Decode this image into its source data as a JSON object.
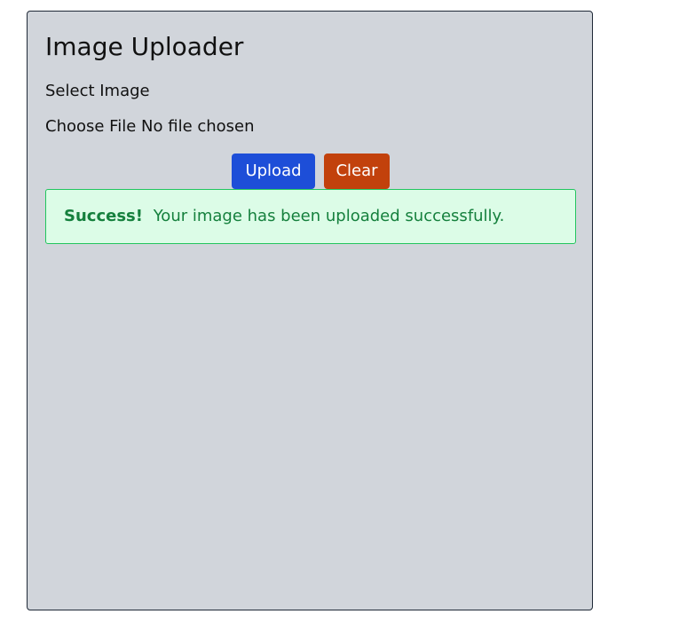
{
  "uploader": {
    "title": "Image Uploader",
    "select_label": "Select Image",
    "file_input": {
      "button_label": "Choose File",
      "status": "No file chosen"
    },
    "upload_button": "Upload",
    "clear_button": "Clear",
    "alert": {
      "heading": "Success!",
      "message": "Your image has been uploaded successfully."
    }
  },
  "colors": {
    "card_background": "#d1d5db",
    "upload_button": "#1d4ed8",
    "clear_button": "#c2410c",
    "alert_background": "#dcfce7",
    "alert_text": "#15803d"
  }
}
